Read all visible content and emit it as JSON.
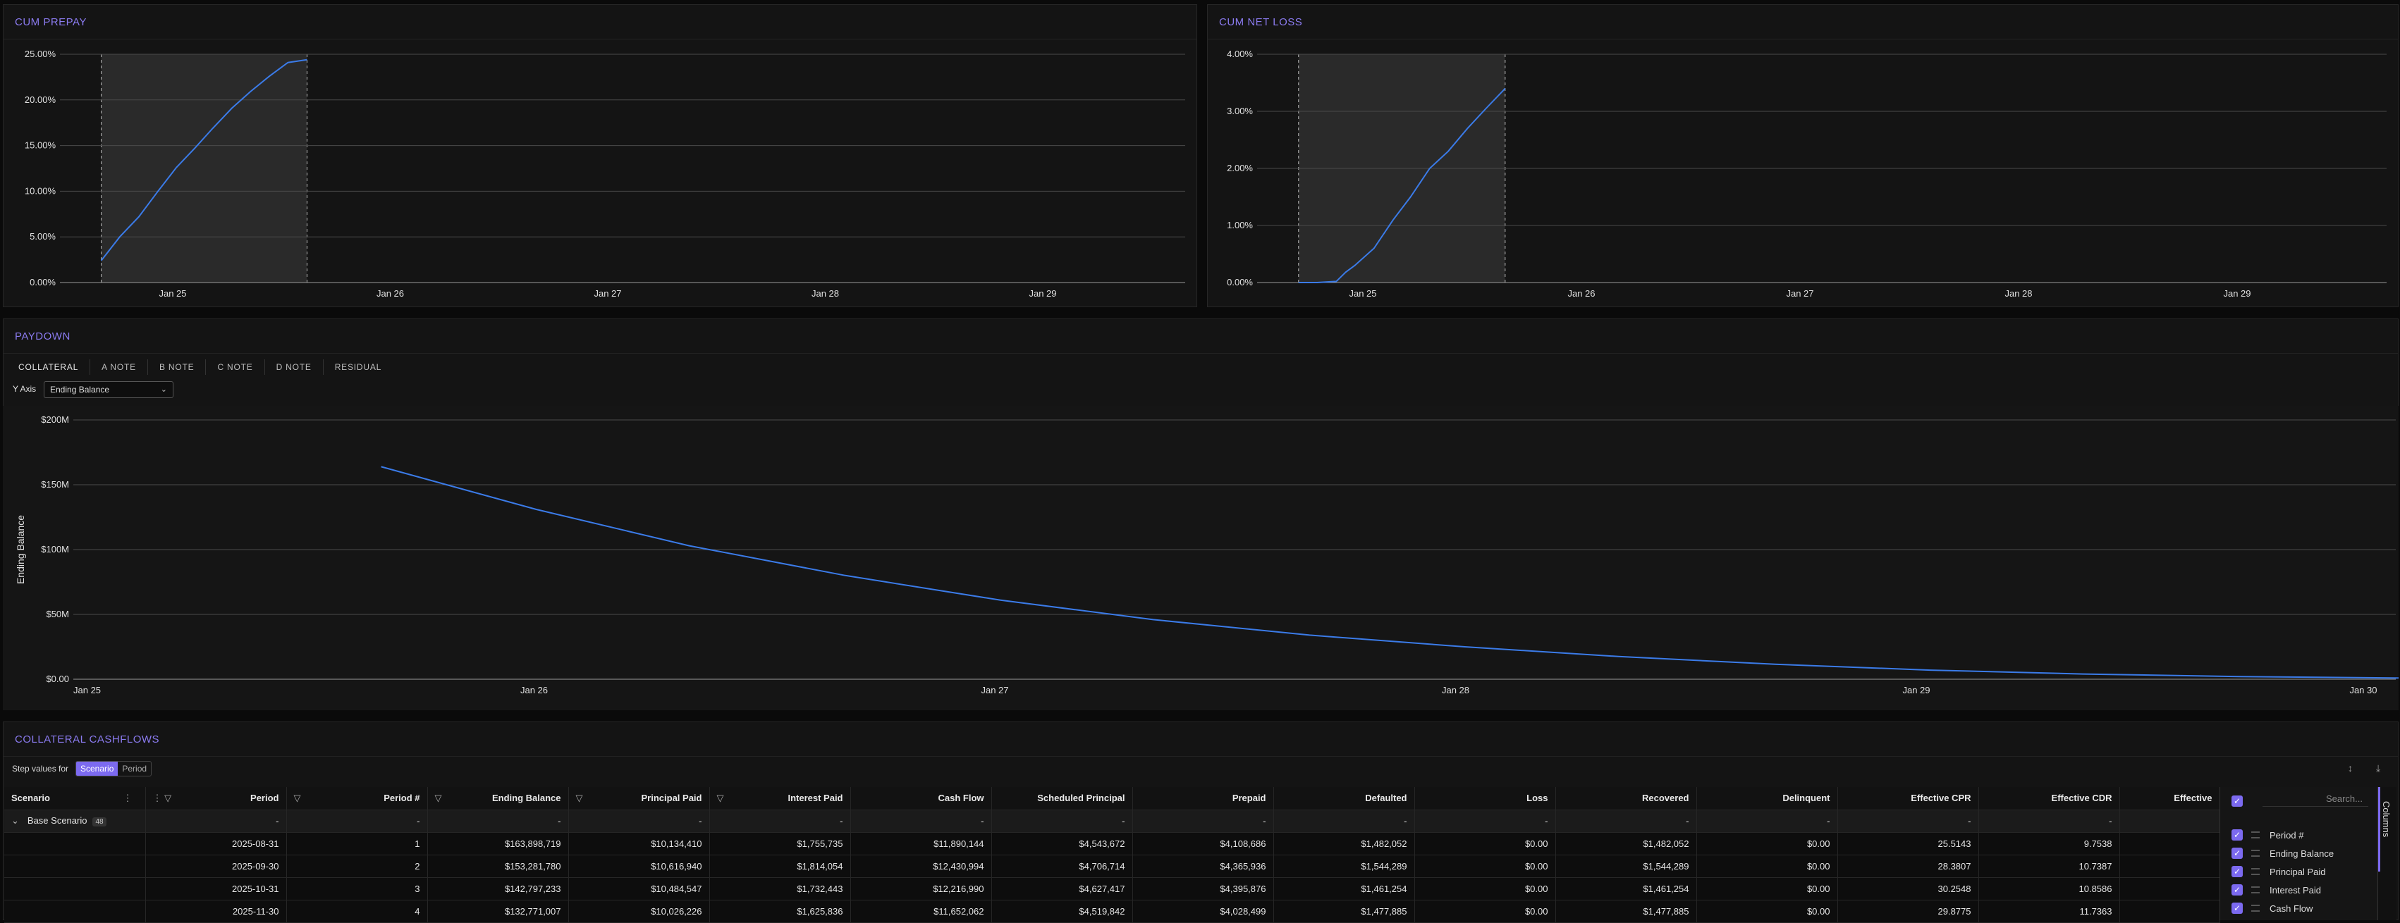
{
  "cum_prepay": {
    "title": "CUM PREPAY",
    "chart_data": {
      "type": "line",
      "title": "CUM PREPAY",
      "x_ticks": [
        "Jan 25",
        "Jan 26",
        "Jan 27",
        "Jan 28",
        "Jan 29"
      ],
      "y_ticks": [
        "0.00%",
        "5.00%",
        "10.00%",
        "15.00%",
        "20.00%",
        "25.00%"
      ],
      "ylim": [
        0,
        25
      ],
      "highlight_range": [
        "2024-08-31",
        "2025-07-31"
      ],
      "series": [
        {
          "x": [
            "2024-08-31",
            "2024-09-30",
            "2024-10-31",
            "2024-11-30",
            "2024-12-31",
            "2025-01-31",
            "2025-02-28",
            "2025-03-31",
            "2025-04-30",
            "2025-05-31",
            "2025-06-30",
            "2025-07-31"
          ],
          "y": [
            2.4,
            5.0,
            7.2,
            9.9,
            12.6,
            14.8,
            16.9,
            19.1,
            20.9,
            22.6,
            24.1,
            24.4
          ]
        }
      ],
      "color": "#3b7be8"
    }
  },
  "cum_net_loss": {
    "title": "CUM NET LOSS",
    "chart_data": {
      "type": "line",
      "title": "CUM NET LOSS",
      "x_ticks": [
        "Jan 25",
        "Jan 26",
        "Jan 27",
        "Jan 28",
        "Jan 29"
      ],
      "y_ticks": [
        "0.00%",
        "1.00%",
        "2.00%",
        "3.00%",
        "4.00%"
      ],
      "ylim": [
        0,
        4
      ],
      "highlight_range": [
        "2024-08-31",
        "2025-07-31"
      ],
      "series": [
        {
          "x": [
            "2024-08-31",
            "2024-09-30",
            "2024-10-31",
            "2024-11-15",
            "2024-11-30",
            "2024-12-31",
            "2025-01-31",
            "2025-02-28",
            "2025-03-31",
            "2025-04-30",
            "2025-05-31",
            "2025-06-30",
            "2025-07-31"
          ],
          "y": [
            0.0,
            0.0,
            0.02,
            0.18,
            0.3,
            0.6,
            1.1,
            1.5,
            2.0,
            2.3,
            2.7,
            3.05,
            3.4
          ]
        }
      ],
      "color": "#3b7be8"
    }
  },
  "paydown": {
    "title": "PAYDOWN",
    "tabs": [
      "COLLATERAL",
      "A NOTE",
      "B NOTE",
      "C NOTE",
      "D NOTE",
      "RESIDUAL"
    ],
    "y_axis_label": "Y Axis",
    "y_axis_value": "Ending Balance",
    "chart_data": {
      "type": "line",
      "ylabel": "Ending Balance",
      "x_ticks": [
        "Jan 25",
        "Jan 26",
        "Jan 27",
        "Jan 28",
        "Jan 29",
        "Jan 30"
      ],
      "y_ticks": [
        "$0.00",
        "$50M",
        "$100M",
        "$150M",
        "$200M"
      ],
      "ylim": [
        0,
        200
      ],
      "series": [
        {
          "x": [
            "2025-08-31",
            "2025-12-31",
            "2026-04-30",
            "2026-08-31",
            "2026-12-31",
            "2027-04-30",
            "2027-08-31",
            "2027-12-31",
            "2028-04-30",
            "2028-08-31",
            "2028-12-31",
            "2029-04-30",
            "2029-08-31",
            "2029-12-31",
            "2030-04-30"
          ],
          "y": [
            163.9,
            131,
            103,
            80,
            61,
            46,
            34,
            25,
            17.5,
            11.5,
            7,
            4,
            2,
            1,
            0.3
          ]
        }
      ],
      "color": "#3b7be8"
    }
  },
  "cashflows": {
    "title": "COLLATERAL CASHFLOWS",
    "step_label": "Step values for",
    "step_options": [
      "Scenario",
      "Period"
    ],
    "columns": [
      "Scenario",
      "Period",
      "Period #",
      "Ending Balance",
      "Principal Paid",
      "Interest Paid",
      "Cash Flow",
      "Scheduled Principal",
      "Prepaid",
      "Defaulted",
      "Loss",
      "Recovered",
      "Delinquent",
      "Effective CPR",
      "Effective CDR",
      "Effective"
    ],
    "group_row": {
      "label": "Base Scenario",
      "count": "48",
      "placeholder": "-"
    },
    "rows": [
      [
        "",
        "2025-08-31",
        "1",
        "$163,898,719",
        "$10,134,410",
        "$1,755,735",
        "$11,890,144",
        "$4,543,672",
        "$4,108,686",
        "$1,482,052",
        "$0.00",
        "$1,482,052",
        "$0.00",
        "25.5143",
        "9.7538",
        ""
      ],
      [
        "",
        "2025-09-30",
        "2",
        "$153,281,780",
        "$10,616,940",
        "$1,814,054",
        "$12,430,994",
        "$4,706,714",
        "$4,365,936",
        "$1,544,289",
        "$0.00",
        "$1,544,289",
        "$0.00",
        "28.3807",
        "10.7387",
        ""
      ],
      [
        "",
        "2025-10-31",
        "3",
        "$142,797,233",
        "$10,484,547",
        "$1,732,443",
        "$12,216,990",
        "$4,627,417",
        "$4,395,876",
        "$1,461,254",
        "$0.00",
        "$1,461,254",
        "$0.00",
        "30.2548",
        "10.8586",
        ""
      ],
      [
        "",
        "2025-11-30",
        "4",
        "$132,771,007",
        "$10,026,226",
        "$1,625,836",
        "$11,652,062",
        "$4,519,842",
        "$4,028,499",
        "$1,477,885",
        "$0.00",
        "$1,477,885",
        "$0.00",
        "29.8775",
        "11.7363",
        ""
      ]
    ],
    "column_panel": {
      "search_placeholder": "Search...",
      "items": [
        "Period #",
        "Ending Balance",
        "Principal Paid",
        "Interest Paid",
        "Cash Flow"
      ],
      "tab_label": "Columns"
    }
  }
}
